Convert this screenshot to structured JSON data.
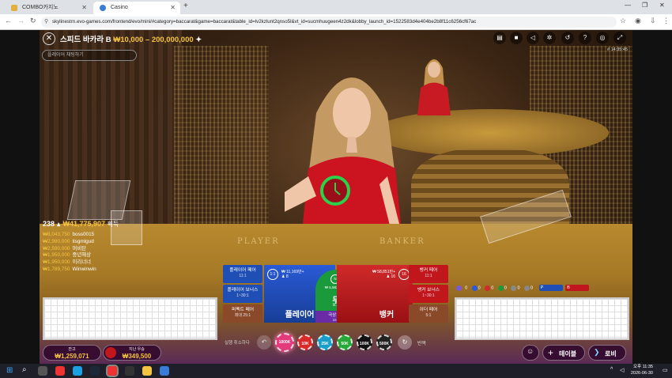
{
  "browser": {
    "tabs": [
      {
        "title": "COMBO카지노"
      },
      {
        "title": "Casino"
      }
    ],
    "url": "skylinestrn.evo-games.com/frontend/evo/mini/#category=baccarat&game=baccarat&table_id=lv2kzlunt2qnso5l&vt_id=sucmhuugeen4z2dk&lobby_launch_id=1522583d4e404be2b8f11c6256cf67ac"
  },
  "game": {
    "title": "스피드 바카라 B",
    "limit": "₩10,000 – 200,000,000",
    "chat_placeholder": "플레이어 채팅하기",
    "clock": "# 14:35:45",
    "felt_player": "PLAYER",
    "felt_banker": "BANKER"
  },
  "winners": {
    "count": "238",
    "total": "₩41,775,907",
    "suffix": "획득",
    "rows": [
      {
        "amount": "₩8,043,750",
        "name": "boss0015"
      },
      {
        "amount": "₩2,980,000",
        "name": "tisgmlgud"
      },
      {
        "amount": "₩2,590,000",
        "name": "머비탄"
      },
      {
        "amount": "₩1,950,000",
        "name": "중년해상"
      },
      {
        "amount": "₩1,950,000",
        "name": "이리너너"
      },
      {
        "amount": "₩1,789,750",
        "name": "Winwinwin"
      }
    ]
  },
  "bets": {
    "left_side": [
      {
        "label": "플레이어 페어",
        "pay": "11:1"
      },
      {
        "label": "플레이어 보너스",
        "pay": "1~30:1"
      },
      {
        "label": "퍼펙트 페어",
        "pay": "최대 25:1"
      }
    ],
    "right_side": [
      {
        "label": "뱅커 페어",
        "pay": "11:1"
      },
      {
        "label": "뱅커 보너스",
        "pay": "1~30:1"
      },
      {
        "label": "이더 페어",
        "pay": "5:1"
      }
    ],
    "player": {
      "label": "플레이어",
      "pct": "1:1",
      "amount": "₩ 11,169만+",
      "players": "8"
    },
    "tie": {
      "label": "무",
      "pay": "8:1",
      "amount": "₩ 5,982.84 ₩",
      "players": "3"
    },
    "banker": {
      "label": "뱅커",
      "pct": "16",
      "amount": "₩ 58,851만+",
      "players": "16"
    },
    "super6": {
      "label": "극상의 6",
      "pay": "15:1"
    }
  },
  "stats": {
    "left": [
      "0",
      "0",
      "0",
      "0",
      "0",
      "0"
    ],
    "p_label": "P",
    "b_label": "B"
  },
  "bottom": {
    "balance_label": "잔고",
    "balance": "₩1,259,071",
    "lastwin_label": "지난 우승",
    "lastwin": "₩349,500",
    "undo_label": "실행 취소하다",
    "repeat_label": "반복",
    "chips": [
      "1000K",
      "10K",
      "25K",
      "50K",
      "100K",
      "500K"
    ],
    "table_label": "테이블",
    "lobby_label": "로비"
  },
  "taskbar": {
    "time": "오후 11:35",
    "date": "2026-06-30"
  },
  "colors": {
    "accent_gold": "#f5c542",
    "player_blue": "#1f4fb5",
    "banker_red": "#c0161c",
    "tie_green": "#1a9a3a",
    "timer_green": "#2bd14b"
  }
}
